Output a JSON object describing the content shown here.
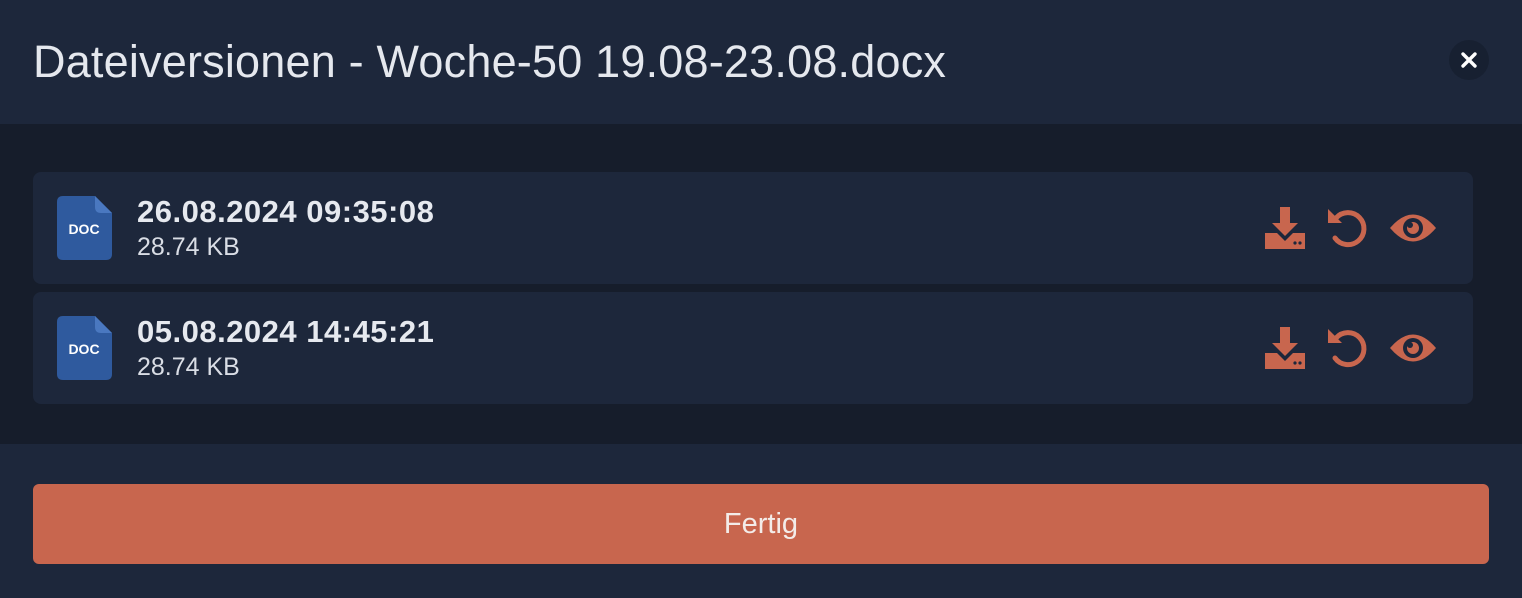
{
  "dialog": {
    "title": "Dateiversionen - Woche-50 19.08-23.08.docx",
    "close_icon": "close-icon"
  },
  "versions": [
    {
      "file_badge": "DOC",
      "timestamp": "26.08.2024 09:35:08",
      "size": "28.74 KB",
      "actions": [
        "download-icon",
        "restore-icon",
        "eye-icon"
      ]
    },
    {
      "file_badge": "DOC",
      "timestamp": "05.08.2024 14:45:21",
      "size": "28.74 KB",
      "actions": [
        "download-icon",
        "restore-icon",
        "eye-icon"
      ]
    }
  ],
  "footer": {
    "done_label": "Fertig"
  },
  "colors": {
    "background": "#1d273b",
    "list_background": "#161d2b",
    "accent": "#c8664e",
    "doc_icon": "#2f5a9e"
  }
}
